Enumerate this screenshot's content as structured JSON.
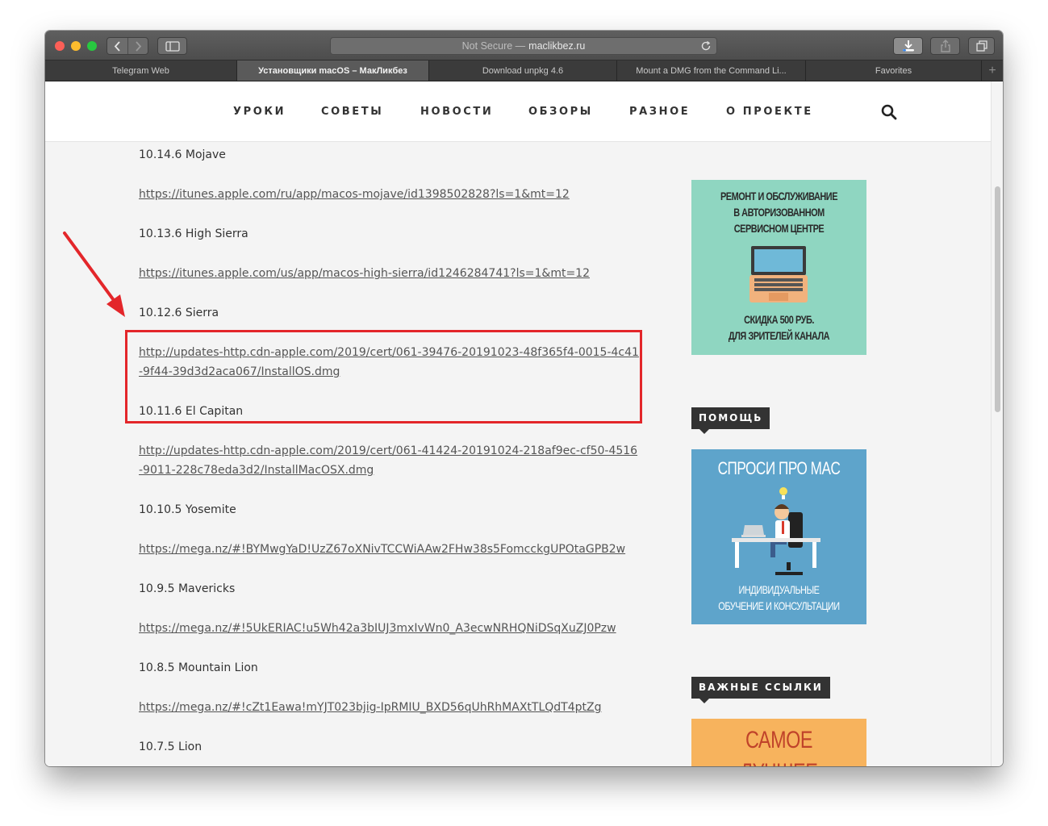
{
  "browser": {
    "address": {
      "secure_label": "Not Secure —",
      "host": "maclikbez.ru"
    },
    "tabs": [
      {
        "label": "Telegram Web",
        "active": false
      },
      {
        "label": "Установщики macOS – МакЛикбез",
        "active": true
      },
      {
        "label": "Download unpkg 4.6",
        "active": false
      },
      {
        "label": "Mount a DMG from the Command Li...",
        "active": false
      },
      {
        "label": "Favorites",
        "active": false
      }
    ],
    "new_tab": "+"
  },
  "site_nav": {
    "items": [
      "УРОКИ",
      "СОВЕТЫ",
      "НОВОСТИ",
      "ОБЗОРЫ",
      "РАЗНОЕ",
      "О ПРОЕКТЕ"
    ]
  },
  "content": {
    "entries": [
      {
        "version": "10.14.6 Mojave",
        "link": "https://itunes.apple.com/ru/app/macos-mojave/id1398502828?ls=1&mt=12"
      },
      {
        "version": "10.13.6 High Sierra",
        "link": "https://itunes.apple.com/us/app/macos-high-sierra/id1246284741?ls=1&mt=12"
      },
      {
        "version": "10.12.6 Sierra",
        "link": "http://updates-http.cdn-apple.com/2019/cert/061-39476-20191023-48f365f4-0015-4c41-9f44-39d3d2aca067/InstallOS.dmg"
      },
      {
        "version": "10.11.6 El Capitan",
        "link": "http://updates-http.cdn-apple.com/2019/cert/061-41424-20191024-218af9ec-cf50-4516-9011-228c78eda3d2/InstallMacOSX.dmg"
      },
      {
        "version": "10.10.5 Yosemite",
        "link": "https://mega.nz/#!BYMwgYaD!UzZ67oXNivTCCWiAAw2FHw38s5FomcckgUPOtaGPB2w"
      },
      {
        "version": "10.9.5 Mavericks",
        "link": "https://mega.nz/#!5UkERIAC!u5Wh42a3bIUJ3mxIvWn0_A3ecwNRHQNiDSqXuZJ0Pzw"
      },
      {
        "version": "10.8.5 Mountain Lion",
        "link": "https://mega.nz/#!cZt1Eawa!mYJT023bjig-IpRMIU_BXD56qUhRhMAXtTLQdT4ptZg"
      },
      {
        "version": "10.7.5 Lion",
        "link": ""
      }
    ]
  },
  "sidebar": {
    "repair_banner": {
      "line1": "РЕМОНТ И ОБСЛУЖИВАНИЕ",
      "line2": "В АВТОРИЗОВАННОМ",
      "line3": "СЕРВИСНОМ ЦЕНТРЕ",
      "line4": "СКИДКА 500 РУБ.",
      "line5": "ДЛЯ ЗРИТЕЛЕЙ КАНАЛА"
    },
    "help_label": "ПОМОЩЬ",
    "ask_banner": {
      "title": "СПРОСИ ПРО MAC",
      "line1": "ИНДИВИДУАЛЬНЫЕ",
      "line2": "ОБУЧЕНИЕ И КОНСУЛЬТАЦИИ"
    },
    "links_label": "ВАЖНЫЕ ССЫЛКИ",
    "best_banner": {
      "line1": "САМОЕ",
      "line2": "ЛУЧШЕЕ"
    }
  },
  "colors": {
    "highlight": "#e3262a",
    "repair_banner_bg": "#8fd6c1",
    "ask_banner_bg": "#5ea4cb",
    "best_banner_bg": "#f7b35d"
  }
}
